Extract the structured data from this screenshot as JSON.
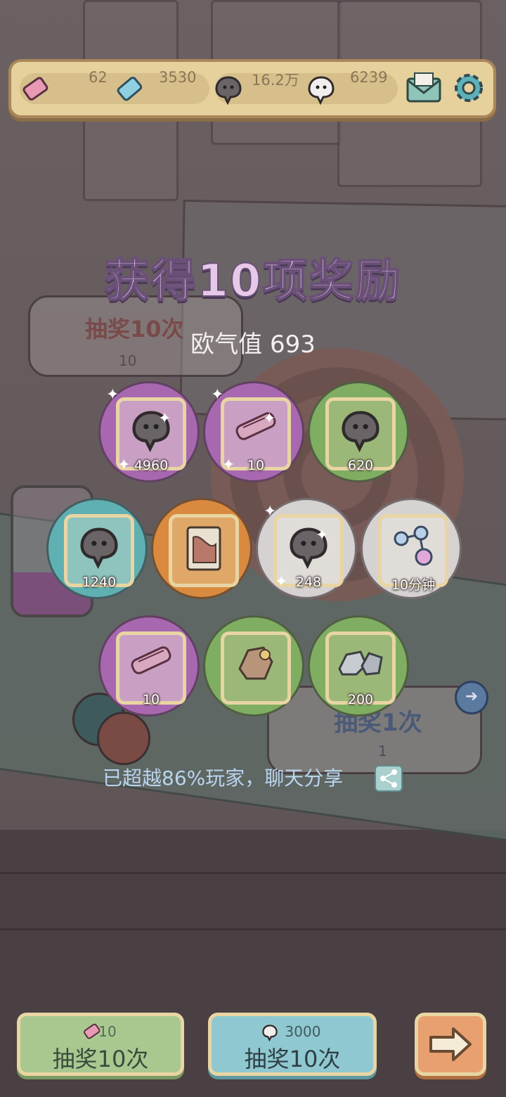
{
  "resources": [
    {
      "name": "ticket-pink",
      "value": "62"
    },
    {
      "name": "ticket-blue",
      "value": "3530"
    },
    {
      "name": "ghost-gray",
      "value": "16.2万"
    },
    {
      "name": "ghost-white",
      "value": "6239"
    }
  ],
  "title": "获得10项奖励",
  "luck_label": "欧气值 693",
  "bg_panel_10": {
    "label": "抽奖10次",
    "cost": "10"
  },
  "bg_panel_1": {
    "label": "抽奖1次",
    "cost": "1"
  },
  "rewards": [
    {
      "item": "ghost-icon",
      "qty": "4960",
      "circle": "#a868b0",
      "card": "#c9a0c4"
    },
    {
      "item": "scroll-icon",
      "qty": "10",
      "circle": "#a868b0",
      "card": "#c9a0c4"
    },
    {
      "item": "ghost-icon",
      "qty": "620",
      "circle": "#7fae62",
      "card": "#9cb878"
    },
    {
      "item": "ghost-icon",
      "qty": "1240",
      "circle": "#5fb0b2",
      "card": "#8fc4be"
    },
    {
      "item": "book-icon",
      "qty": "",
      "circle": "#d98a3e",
      "card": "#e0a868"
    },
    {
      "item": "ghost-icon",
      "qty": "248",
      "circle": "#d6d2d2",
      "card": "#e0dcd8"
    },
    {
      "item": "molecule-icon",
      "qty": "10分钟",
      "circle": "#d6d2d2",
      "card": "#e0dcd8"
    },
    {
      "item": "scroll-icon",
      "qty": "10",
      "circle": "#a868b0",
      "card": "#c9a0c4"
    },
    {
      "item": "ore-icon",
      "qty": "",
      "circle": "#7fae62",
      "card": "#9cb878"
    },
    {
      "item": "stone-icon",
      "qty": "200",
      "circle": "#7fae62",
      "card": "#9cb878"
    }
  ],
  "rank_text": "已超越86%玩家，聊天分享",
  "buttons": {
    "draw10_ticket": {
      "cost": "10",
      "label": "抽奖10次"
    },
    "draw10_ghost": {
      "cost": "3000",
      "label": "抽奖10次"
    }
  }
}
